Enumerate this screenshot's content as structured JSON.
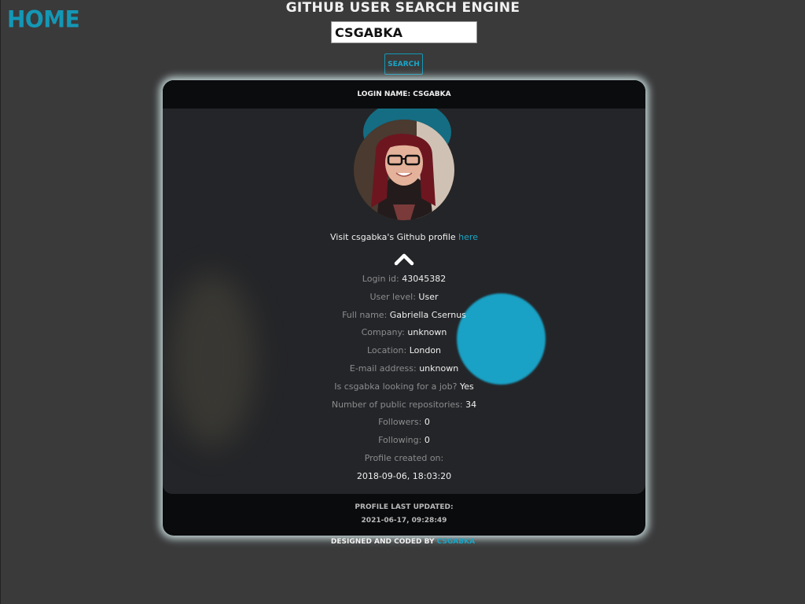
{
  "nav": {
    "home_label": "HOME"
  },
  "header": {
    "title": "GITHUB USER SEARCH ENGINE"
  },
  "search": {
    "value": "CSGABKA",
    "button_label": "SEARCH"
  },
  "card": {
    "login_header": "LOGIN NAME: CSGABKA",
    "visit_prefix": "Visit csgabka's Github profile",
    "visit_link": "here",
    "toggle_icon": "chevron-up-icon",
    "fields": [
      {
        "label": "Login id:",
        "value": "43045382"
      },
      {
        "label": "User level:",
        "value": "User"
      },
      {
        "label": "Full name:",
        "value": "Gabriella Csernus"
      },
      {
        "label": "Company:",
        "value": "unknown"
      },
      {
        "label": "Location:",
        "value": "London"
      },
      {
        "label": "E-mail address:",
        "value": "unknown"
      },
      {
        "label": "Is csgabka looking for a job?",
        "value": "Yes"
      },
      {
        "label": "Number of public repositories:",
        "value": "34"
      },
      {
        "label": "Followers:",
        "value": "0"
      },
      {
        "label": "Following:",
        "value": "0"
      }
    ],
    "created_label": "Profile created on:",
    "created_value": "2018-09-06, 18:03:20",
    "updated_label": "PROFILE LAST UPDATED:",
    "updated_value": "2021-06-17, 09:28:49"
  },
  "credit": {
    "prefix": "DESIGNED AND CODED BY",
    "author": "CSGABKA"
  },
  "colors": {
    "accent": "#1aa6c6",
    "background": "#3a3a3b",
    "card": "#242528"
  }
}
